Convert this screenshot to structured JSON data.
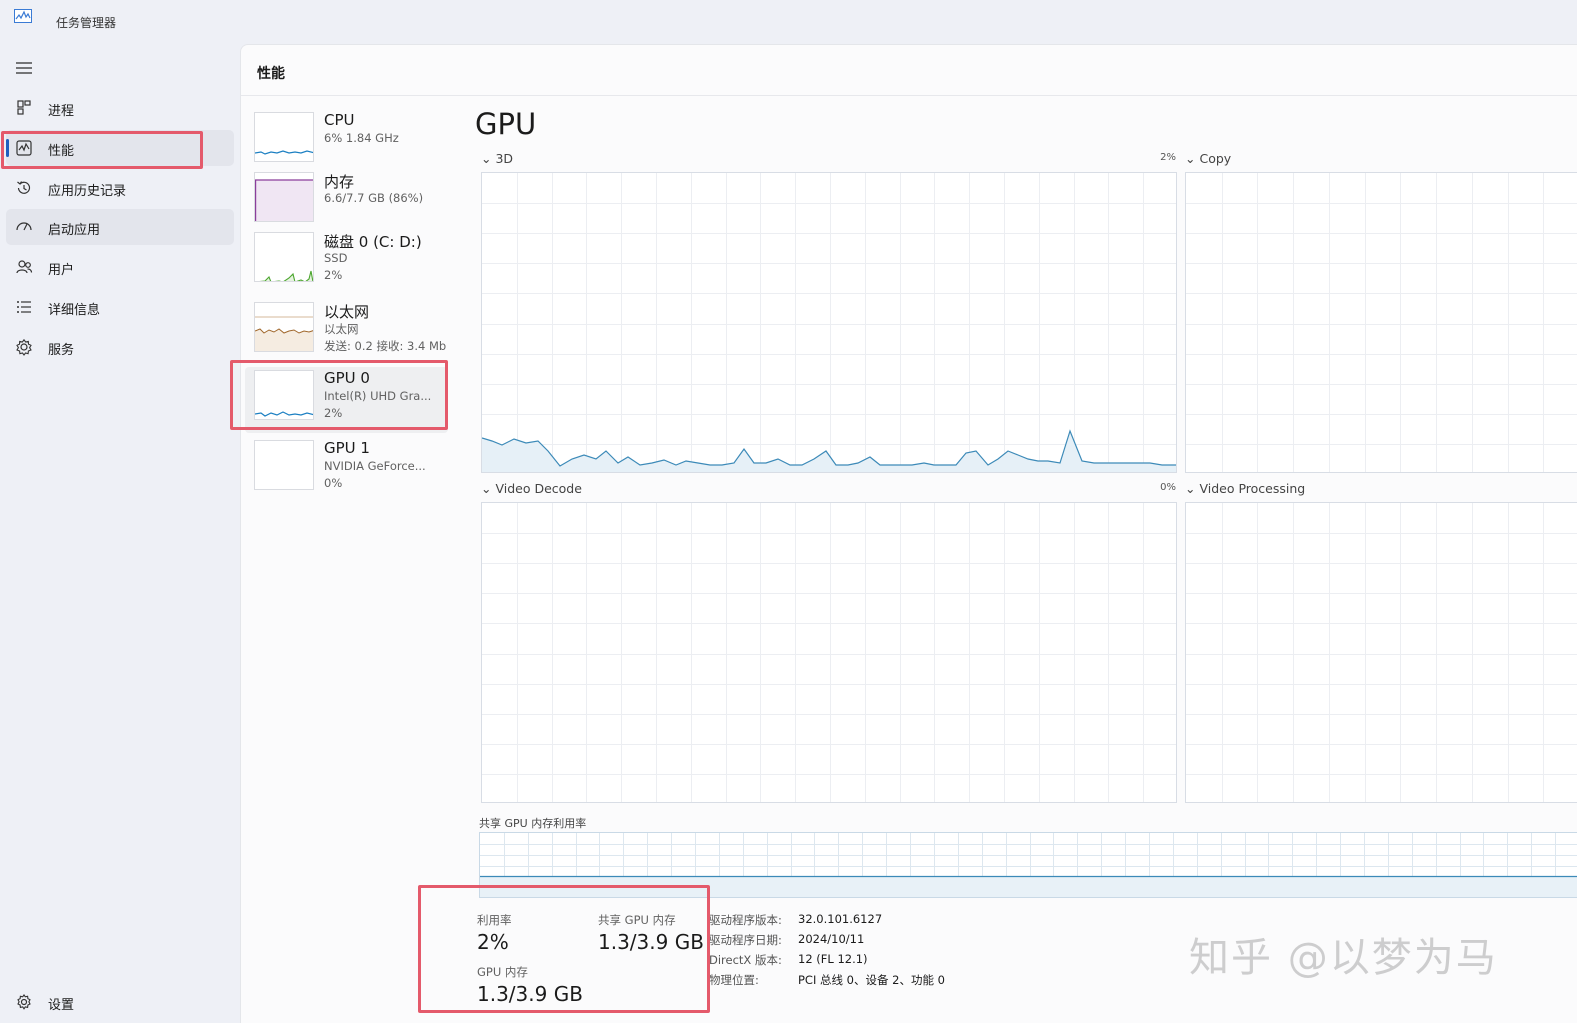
{
  "window": {
    "title": "任务管理器"
  },
  "nav": {
    "items": [
      {
        "label": "进程",
        "icon": "processes-icon"
      },
      {
        "label": "性能",
        "icon": "performance-icon"
      },
      {
        "label": "应用历史记录",
        "icon": "history-icon"
      },
      {
        "label": "启动应用",
        "icon": "startup-icon"
      },
      {
        "label": "用户",
        "icon": "users-icon"
      },
      {
        "label": "详细信息",
        "icon": "details-icon"
      },
      {
        "label": "服务",
        "icon": "services-icon"
      }
    ],
    "settings_label": "设置"
  },
  "header": {
    "title": "性能"
  },
  "resources": [
    {
      "name": "CPU",
      "sub1": "6% 1.84 GHz"
    },
    {
      "name": "内存",
      "sub1": "6.6/7.7 GB (86%)"
    },
    {
      "name": "磁盘 0 (C: D:)",
      "sub1": "SSD",
      "sub2": "2%"
    },
    {
      "name": "以太网",
      "sub1": "以太网",
      "sub2": "发送: 0.2 接收: 3.4 Mb"
    },
    {
      "name": "GPU 0",
      "sub1": "Intel(R) UHD Gra...",
      "sub2": "2%"
    },
    {
      "name": "GPU 1",
      "sub1": "NVIDIA GeForce...",
      "sub2": "0%"
    }
  ],
  "detail": {
    "title": "GPU",
    "engines": [
      {
        "label": "3D",
        "pct": "2%"
      },
      {
        "label": "Copy"
      },
      {
        "label": "Video Decode",
        "pct": "0%"
      },
      {
        "label": "Video Processing"
      }
    ],
    "shared_memory_label": "共享 GPU 内存利用率",
    "stats": {
      "utilization_label": "利用率",
      "utilization_value": "2%",
      "shared_gpu_memory_label": "共享 GPU 内存",
      "shared_gpu_memory_value": "1.3/3.9 GB",
      "gpu_memory_label": "GPU 内存",
      "gpu_memory_value": "1.3/3.9 GB"
    },
    "info": [
      {
        "label": "驱动程序版本:",
        "value": "32.0.101.6127"
      },
      {
        "label": "驱动程序日期:",
        "value": "2024/10/11"
      },
      {
        "label": "DirectX 版本:",
        "value": "12 (FL 12.1)"
      },
      {
        "label": "物理位置:",
        "value": "PCI 总线 0、设备 2、功能 0"
      }
    ]
  },
  "watermark": "知乎 @以梦为马",
  "colors": {
    "accent": "#1f5fbf",
    "highlight": "#e45a6b",
    "graph_line": "#3c8ab8"
  }
}
